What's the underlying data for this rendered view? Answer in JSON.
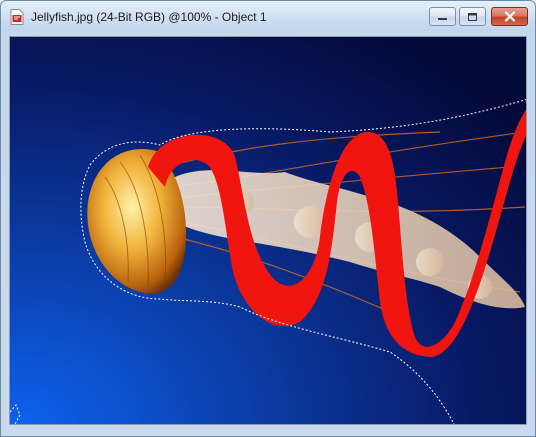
{
  "window": {
    "title": "Jellyfish.jpg (24-Bit RGB) @100% - Object 1",
    "icon": "document-icon"
  },
  "controls": {
    "minimize_icon": "minimize-icon",
    "maximize_icon": "maximize-icon",
    "close_icon": "close-icon"
  },
  "canvas": {
    "image_name": "Jellyfish.jpg",
    "zoom_percent": 100,
    "active_object": "Object 1",
    "colors": {
      "background_deep": "#040b3c",
      "background_blue": "#0c4fc7",
      "stroke_red": "#f0150f",
      "jellyfish_orange": "#e59a22"
    }
  }
}
